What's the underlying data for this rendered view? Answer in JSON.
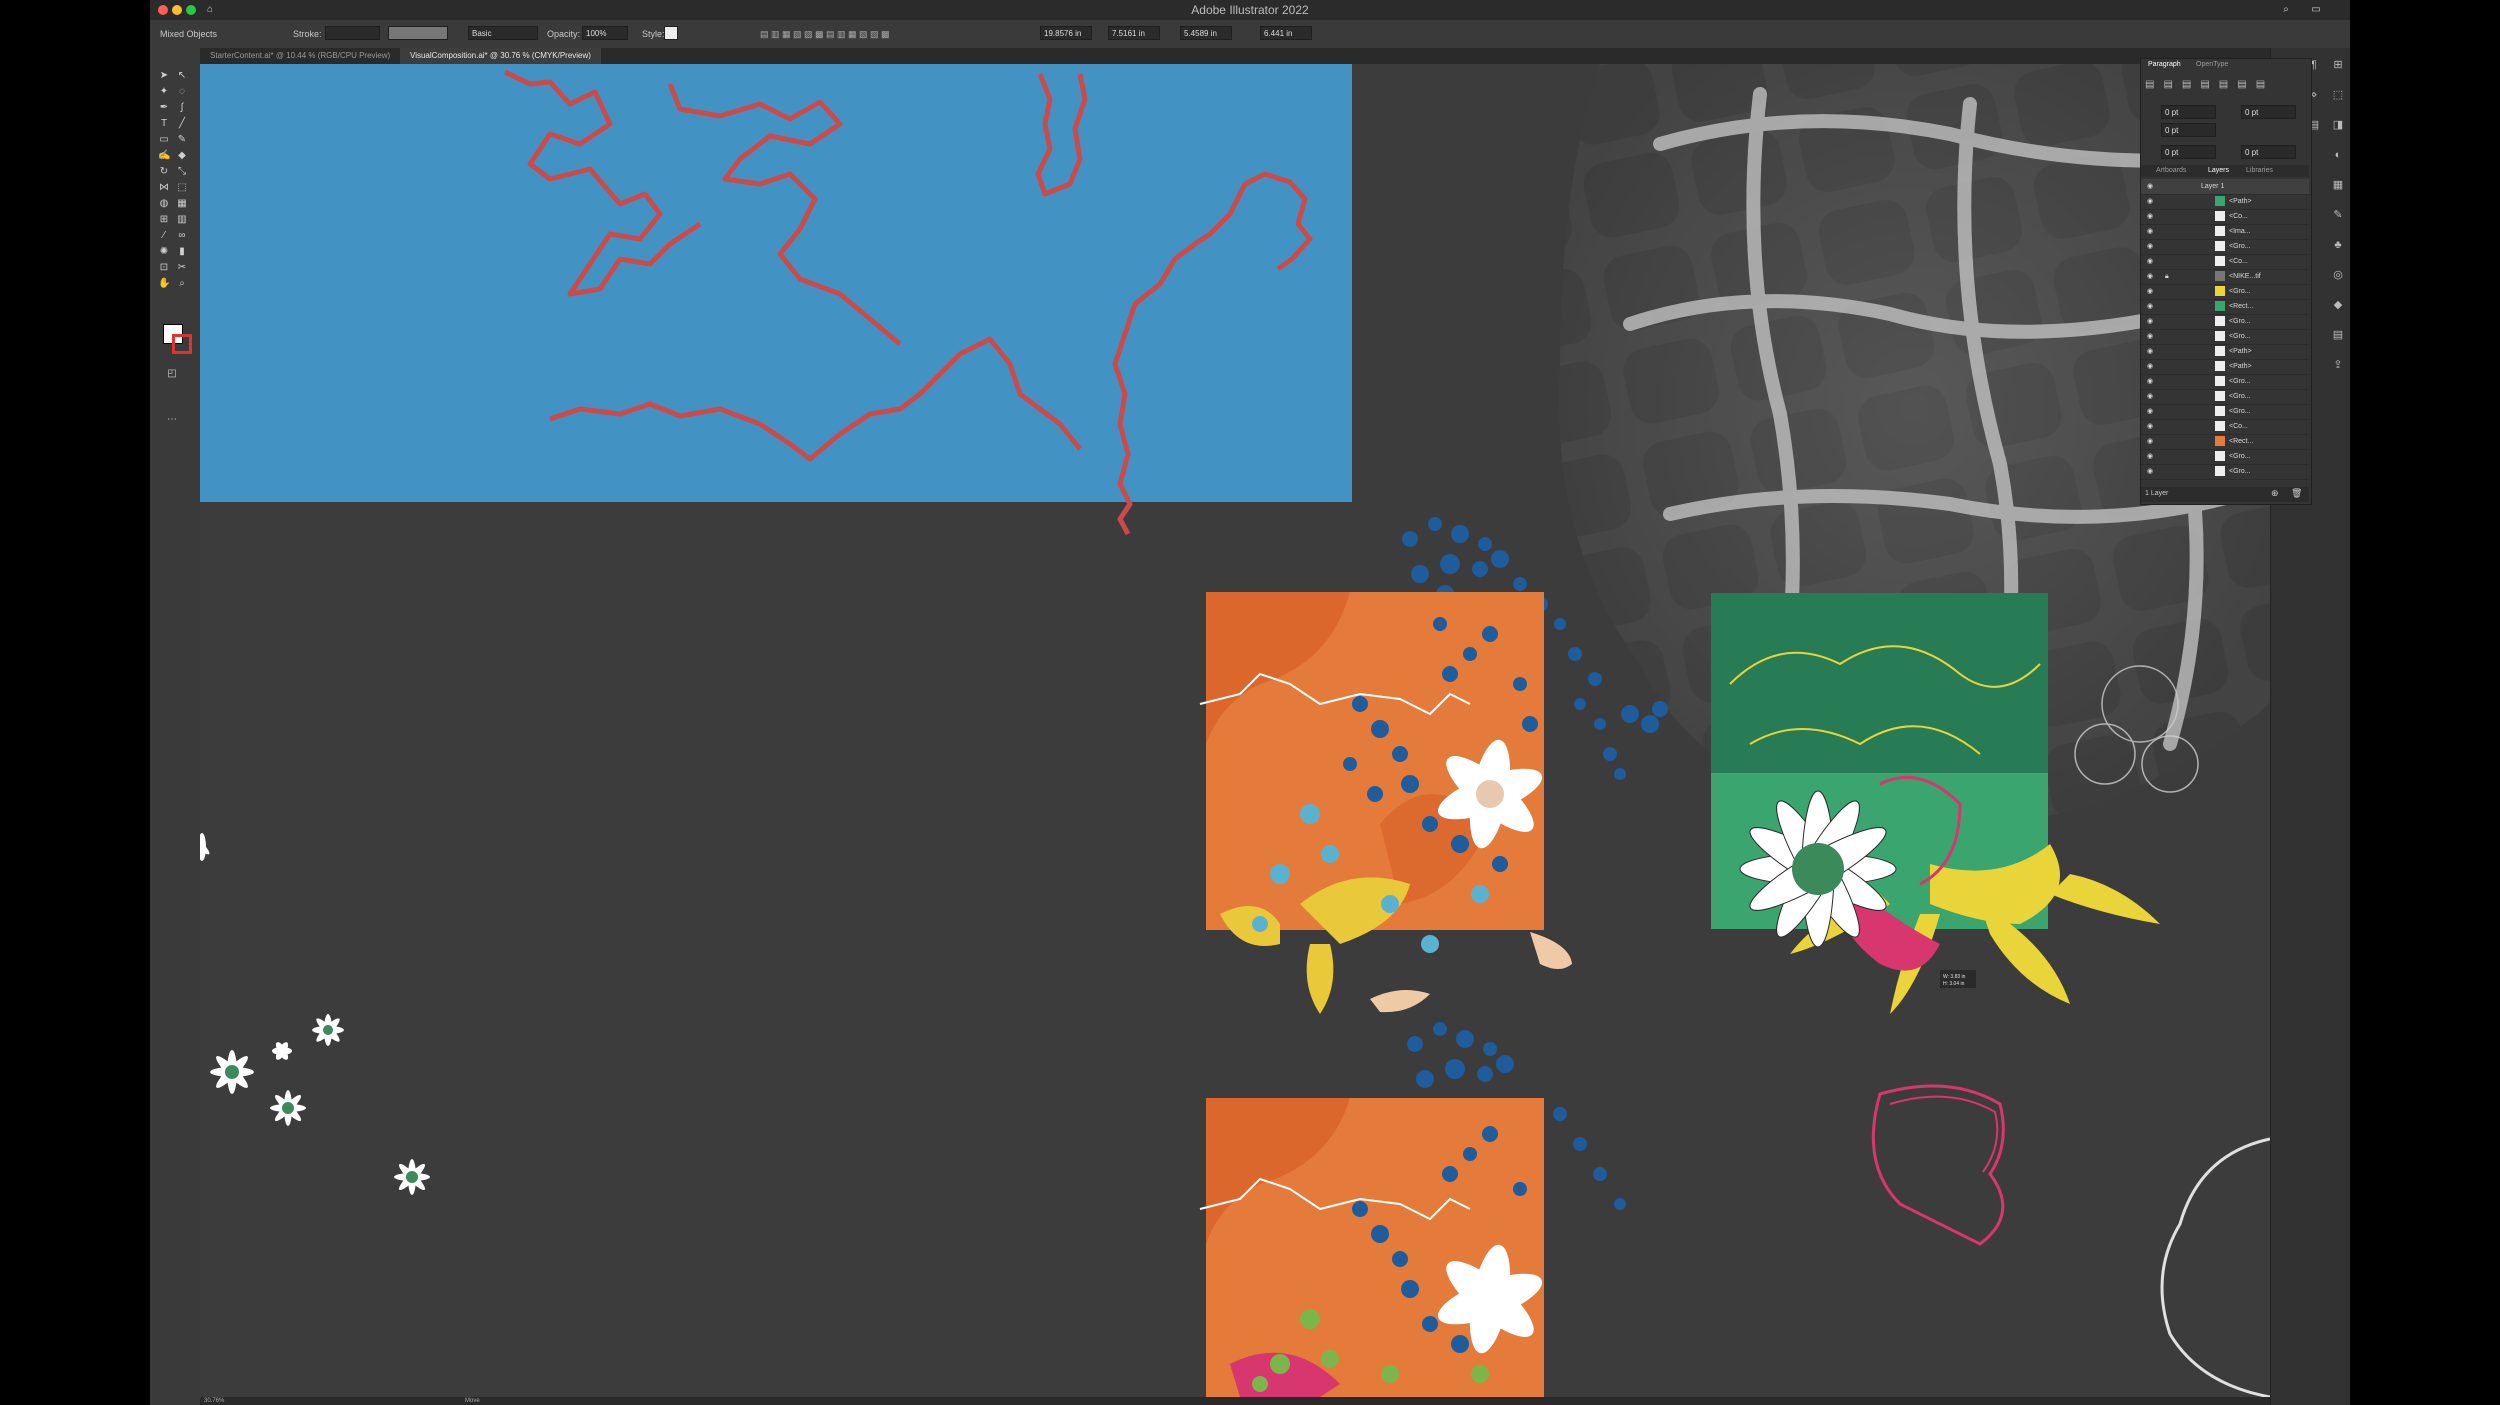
{
  "app": {
    "title": "Adobe Illustrator 2022"
  },
  "control_bar": {
    "selection": "Mixed Objects",
    "stroke_label": "Stroke:",
    "brush": "Basic",
    "opacity_label": "Opacity:",
    "opacity_value": "100%",
    "style_label": "Style:",
    "x": "19.8576 in",
    "y": "7.5161 in",
    "w": "5.4589 in",
    "h": "6.441 in"
  },
  "tabs": [
    {
      "label": "StarterContent.ai* @ 10.44 % (RGB/CPU Preview)"
    },
    {
      "label": "VisualComposition.ai* @ 30.76 % (CMYK/Preview)"
    }
  ],
  "panels": {
    "paragraph_tabs": [
      "Paragraph",
      "OpenType"
    ],
    "paragraph_values": [
      "0 pt",
      "0 pt",
      "0 pt",
      "0 pt",
      "0 pt"
    ],
    "layers_tabs": [
      "Artboards",
      "Layers",
      "Libraries"
    ],
    "layer_rows": [
      "Layer 1",
      "<Path>",
      "<Co...",
      "<Ima...",
      "<Gro...",
      "<Co...",
      "<NIKE...tif",
      "<Gro...",
      "<Rect...",
      "<Gro...",
      "<Gro...",
      "<Path>",
      "<Path>",
      "<Gro...",
      "<Gro...",
      "<Gro...",
      "<Co...",
      "<Rect...",
      "<Gro...",
      "<Gro..."
    ],
    "layers_footer": "1 Layer"
  },
  "status": {
    "zoom": "30.76%",
    "mode": "Move"
  },
  "canvas": {
    "smart_guide": [
      "W: 3.83 in",
      "H: 3.04 in"
    ]
  },
  "colors": {
    "blue": "#4293c3",
    "orange": "#e57b3a",
    "green": "#3aa56e",
    "yellow": "#e9d53a",
    "red_line": "#cb4b4b",
    "pink": "#d8366e"
  }
}
